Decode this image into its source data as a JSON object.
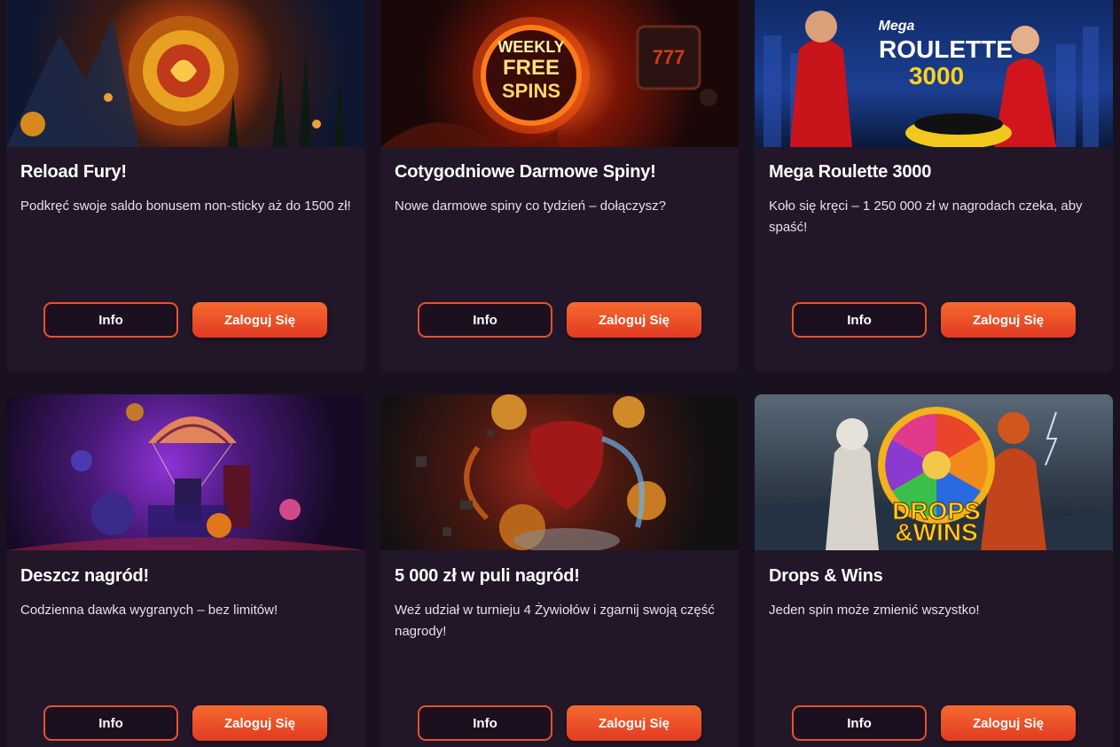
{
  "cards": [
    {
      "title": "Reload Fury!",
      "description": "Podkręć swoje saldo bonusem non-sticky aż do 1500 zł!",
      "info_label": "Info",
      "login_label": "Zaloguj Się"
    },
    {
      "title": "Cotygodniowe Darmowe Spiny!",
      "description": "Nowe darmowe spiny co tydzień – dołączysz?",
      "info_label": "Info",
      "login_label": "Zaloguj Się",
      "banner_text": [
        "WEEKLY",
        "FREE",
        "SPINS"
      ],
      "banner_slot_text": "777"
    },
    {
      "title": "Mega Roulette 3000",
      "description": "Koło się kręci – 1 250 000 zł w nagrodach czeka, aby spaść!",
      "info_label": "Info",
      "login_label": "Zaloguj Się",
      "banner_text": [
        "Mega",
        "ROULETTE",
        "3000"
      ]
    },
    {
      "title": "Deszcz nagród!",
      "description": "Codzienna dawka wygranych – bez limitów!",
      "info_label": "Info",
      "login_label": "Zaloguj Się"
    },
    {
      "title": "5 000 zł w puli nagród!",
      "description": "Weź udział w turnieju 4 Żywiołów i zgarnij swoją część nagrody!",
      "info_label": "Info",
      "login_label": "Zaloguj Się"
    },
    {
      "title": "Drops & Wins",
      "description": "Jeden spin może zmienić wszystko!",
      "info_label": "Info",
      "login_label": "Zaloguj Się",
      "banner_text": [
        "DROPS",
        "&WINS"
      ]
    }
  ],
  "colors": {
    "page_bg": "#1a1120",
    "card_bg": "#221729",
    "accent": "#e8512f",
    "button_gradient_top": "#f66a2f",
    "button_gradient_bottom": "#e23a22"
  }
}
